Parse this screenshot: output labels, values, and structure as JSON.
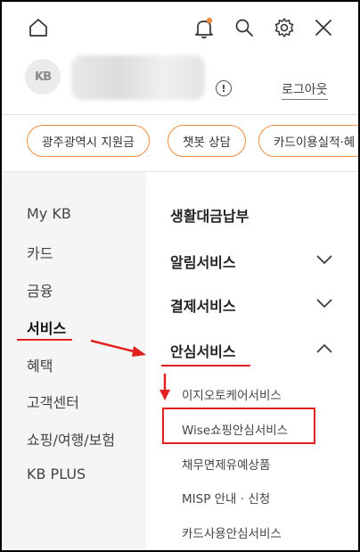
{
  "topbar": {
    "icons": [
      "home-icon",
      "bell-icon",
      "search-icon",
      "gear-icon",
      "close-icon"
    ],
    "notification_dot_color": "#f08a3c"
  },
  "profile": {
    "avatar_text": "KB",
    "logout_label": "로그아웃",
    "info_icon": "!"
  },
  "quick_chips": [
    "광주광역시 지원금",
    "챗봇 상담",
    "카드이용실적·혜"
  ],
  "left_menu": {
    "items": [
      "My KB",
      "카드",
      "금융",
      "서비스",
      "혜택",
      "고객센터",
      "쇼핑/여행/보험",
      "KB PLUS"
    ],
    "active_index": 3
  },
  "right_menu": {
    "items": [
      {
        "label": "생활대금납부",
        "expandable": false
      },
      {
        "label": "알림서비스",
        "expandable": true,
        "expanded": false
      },
      {
        "label": "결제서비스",
        "expandable": true,
        "expanded": false
      },
      {
        "label": "안심서비스",
        "expandable": true,
        "expanded": true
      }
    ],
    "sub_items": [
      "이지오토케어서비스",
      "Wise쇼핑안심서비스",
      "채무면제유예상품",
      "MISP 안내 · 신청",
      "카드사용안심서비스"
    ],
    "highlighted_sub_index": 1
  },
  "colors": {
    "accent_orange": "#ef8c3a",
    "annotation_red": "#e32020",
    "left_menu_bg": "#f5f5f5"
  }
}
